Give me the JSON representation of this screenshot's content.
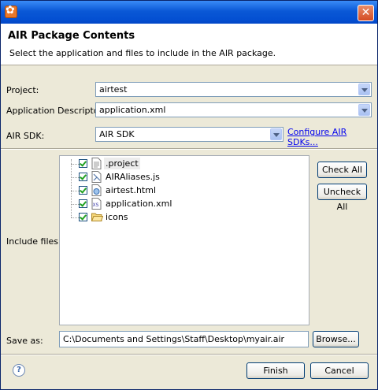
{
  "window": {
    "close_glyph": "✕"
  },
  "banner": {
    "title": "AIR Package Contents",
    "description": "Select the application and files to include in the AIR package."
  },
  "form": {
    "project_label": "Project:",
    "project_value": "airtest",
    "descriptor_label": "Application Descriptor:",
    "descriptor_value": "application.xml",
    "sdk_label": "AIR SDK:",
    "sdk_value": "AIR SDK",
    "configure_link": "Configure AIR SDKs..."
  },
  "include": {
    "label": "Include files:",
    "items": [
      {
        "name": ".project",
        "icon": "text-file-icon",
        "checked": true,
        "selected": true
      },
      {
        "name": "AIRAliases.js",
        "icon": "js-file-icon",
        "checked": true
      },
      {
        "name": "airtest.html",
        "icon": "html-file-icon",
        "checked": true
      },
      {
        "name": "application.xml",
        "icon": "xml-file-icon",
        "checked": true
      },
      {
        "name": "icons",
        "icon": "folder-icon",
        "checked": true
      }
    ],
    "check_all": "Check All",
    "uncheck_all": "Uncheck All"
  },
  "save": {
    "label": "Save as:",
    "value": "C:\\Documents and Settings\\Staff\\Desktop\\myair.air",
    "browse": "Browse..."
  },
  "footer": {
    "help_glyph": "?",
    "finish": "Finish",
    "cancel": "Cancel"
  }
}
